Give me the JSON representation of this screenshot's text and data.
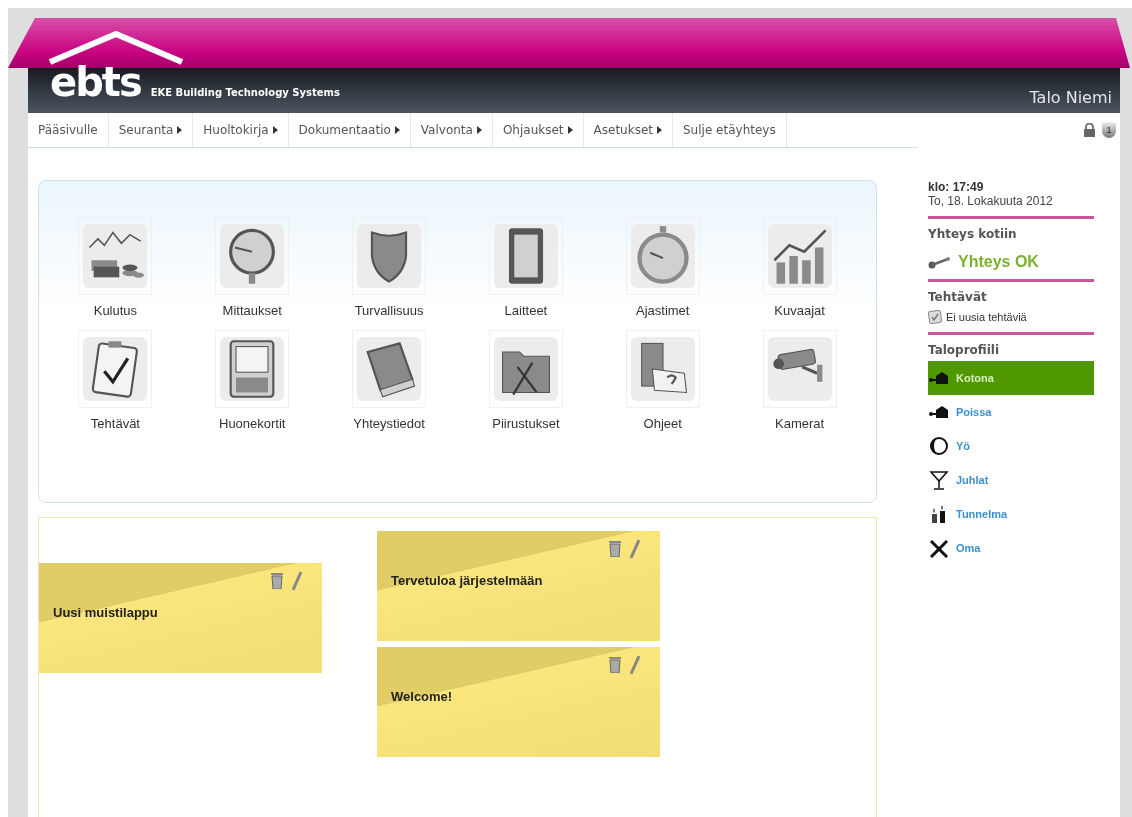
{
  "header": {
    "logo": "ebts",
    "tagline": "EKE Building Technology Systems",
    "site_name": "Talo Niemi",
    "shield_badge": "1"
  },
  "nav": [
    {
      "label": "Pääsivulle",
      "submenu": false
    },
    {
      "label": "Seuranta",
      "submenu": true
    },
    {
      "label": "Huoltokirja",
      "submenu": true
    },
    {
      "label": "Dokumentaatio",
      "submenu": true
    },
    {
      "label": "Valvonta",
      "submenu": true
    },
    {
      "label": "Ohjaukset",
      "submenu": true
    },
    {
      "label": "Asetukset",
      "submenu": true
    },
    {
      "label": "Sulje etäyhteys",
      "submenu": false
    }
  ],
  "modules": [
    {
      "label": "Kulutus",
      "kind": "money"
    },
    {
      "label": "Mittaukset",
      "kind": "gauge"
    },
    {
      "label": "Turvallisuus",
      "kind": "shield"
    },
    {
      "label": "Laitteet",
      "kind": "switch"
    },
    {
      "label": "Ajastimet",
      "kind": "stopwatch"
    },
    {
      "label": "Kuvaajat",
      "kind": "graph"
    },
    {
      "label": "Tehtävät",
      "kind": "clipboard"
    },
    {
      "label": "Huonekortit",
      "kind": "floorplan"
    },
    {
      "label": "Yhteystiedot",
      "kind": "book"
    },
    {
      "label": "Piirustukset",
      "kind": "folder"
    },
    {
      "label": "Ohjeet",
      "kind": "manual"
    },
    {
      "label": "Kamerat",
      "kind": "camera"
    }
  ],
  "note_columns": [
    {
      "notes": [
        {
          "text": "Uusi muistilappu"
        }
      ]
    },
    {
      "notes": [
        {
          "text": "Tervetuloa järjestelmään"
        },
        {
          "text": "Welcome!"
        }
      ]
    }
  ],
  "sidebar": {
    "clock": "klo: 17:49",
    "date": "To, 18. Lokakuuta 2012",
    "connection_title": "Yhteys kotiin",
    "connection_status": "Yhteys OK",
    "connected": true,
    "tasks_title": "Tehtävät",
    "tasks_text": "Ei uusia tehtäviä",
    "profile_title": "Taloprofiili",
    "profiles": [
      {
        "label": "Kotona",
        "kind": "home-in",
        "selected": true
      },
      {
        "label": "Poissa",
        "kind": "home-out",
        "selected": false
      },
      {
        "label": "Yö",
        "kind": "night",
        "selected": false
      },
      {
        "label": "Juhlat",
        "kind": "party",
        "selected": false
      },
      {
        "label": "Tunnelma",
        "kind": "candles",
        "selected": false
      },
      {
        "label": "Oma",
        "kind": "tools",
        "selected": false
      }
    ]
  }
}
